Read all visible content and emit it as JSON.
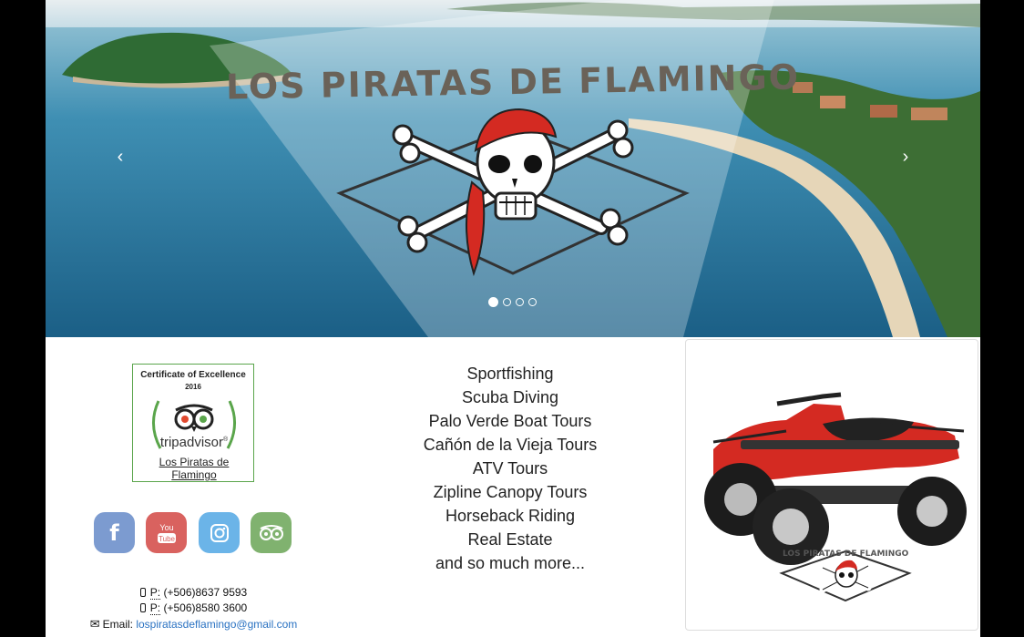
{
  "hero": {
    "title": "LOS PIRATAS DE FLAMINGO",
    "prev_icon": "chevron-left-icon",
    "next_icon": "chevron-right-icon",
    "slide_count": 4,
    "active_slide": 1
  },
  "certificate": {
    "title": "Certificate of Excellence",
    "year": "2016",
    "brand": "tripadvisor",
    "business_name_line1": "Los Piratas de",
    "business_name_line2": "Flamingo"
  },
  "social": [
    {
      "name": "facebook-icon",
      "color": "#7c9bd0"
    },
    {
      "name": "youtube-icon",
      "label": "You Tube",
      "color": "#d9625f"
    },
    {
      "name": "instagram-icon",
      "color": "#6bb4e8"
    },
    {
      "name": "tripadvisor-icon",
      "color": "#80b26f"
    }
  ],
  "contact": {
    "phone_prefix": "P:",
    "phone1": "(+506)8637 9593",
    "phone2": "(+506)8580 3600",
    "email_label": "Email:",
    "email": "lospiratasdeflamingo@gmail.com"
  },
  "services": [
    "Sportfishing",
    "Scuba Diving",
    "Palo Verde Boat Tours",
    "Cañón de la Vieja Tours",
    "ATV Tours",
    "Zipline Canopy Tours",
    "Horseback Riding",
    "Real Estate",
    "and so much more..."
  ],
  "atv_card": {
    "logo_text": "LOS PIRATAS DE FLAMINGO",
    "accent_color": "#d42a22"
  }
}
